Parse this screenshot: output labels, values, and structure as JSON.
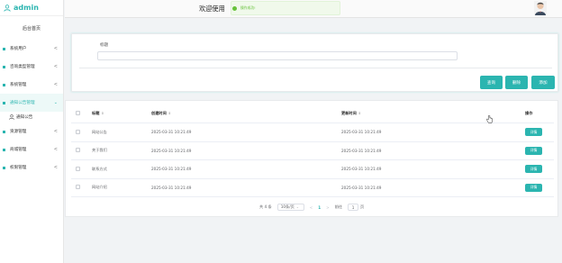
{
  "sidebar": {
    "logo": "admin",
    "home": "后台首页",
    "items": [
      {
        "label": "系统用户",
        "chevron": "<"
      },
      {
        "label": "咨询类型管理",
        "chevron": "<"
      },
      {
        "label": "系统管理",
        "chevron": "<"
      },
      {
        "label": "通知公告管理",
        "chevron": "⌄"
      },
      {
        "label": "资源管理",
        "chevron": "<"
      },
      {
        "label": "商城管理",
        "chevron": "<"
      },
      {
        "label": "权限管理",
        "chevron": "<"
      }
    ],
    "sub_item": "通知公告"
  },
  "header": {
    "welcome": "欢迎使用",
    "toast": "操作成功!"
  },
  "search": {
    "label": "标题",
    "value": "",
    "query_button": "查询",
    "delete_button": "删除",
    "add_button": "添加"
  },
  "table": {
    "columns": [
      "标题",
      "创建时间",
      "更新时间",
      "操作"
    ],
    "sort_glyph": "⇕",
    "rows": [
      {
        "title": "网站公告",
        "created": "2025-03-31 10:21:49",
        "updated": "2025-03-31 10:21:49",
        "action": "详情"
      },
      {
        "title": "关于我们",
        "created": "2025-03-31 10:21:49",
        "updated": "2025-03-31 10:21:49",
        "action": "详情"
      },
      {
        "title": "联系方式",
        "created": "2025-03-31 10:21:49",
        "updated": "2025-03-31 10:21:49",
        "action": "详情"
      },
      {
        "title": "网站介绍",
        "created": "2025-03-31 10:21:49",
        "updated": "2025-03-31 10:21:49",
        "action": "详情"
      }
    ]
  },
  "pager": {
    "total": "共 4 条",
    "page_size": "10条/页",
    "prev": "<",
    "current": "1",
    "next": ">",
    "goto_prefix": "前往",
    "goto_value": "1",
    "goto_suffix": "页"
  },
  "colors": {
    "accent": "#2bb5b0",
    "success": "#67c23a"
  }
}
